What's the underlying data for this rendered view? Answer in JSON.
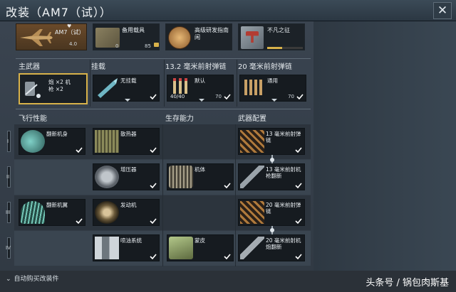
{
  "window": {
    "title": "改装（AM7（试））",
    "close_glyph": "✕"
  },
  "top_items": [
    {
      "name": "AM7（试）",
      "value": "4.0",
      "heart": "♥"
    },
    {
      "name": "备用载具",
      "left_count": "0",
      "right_count": "85"
    },
    {
      "name": "高级研发指南",
      "extra": "闲"
    },
    {
      "name": "不凡之征"
    }
  ],
  "columns": [
    {
      "label": "主武器"
    },
    {
      "label": "挂载"
    },
    {
      "label": "13.2 毫米前射弹链"
    },
    {
      "label": "20 毫米前射弹链"
    }
  ],
  "main_weapon": {
    "line1": "炮 ×2 机",
    "line2": "枪 ×2"
  },
  "pylon": {
    "name": "无挂载"
  },
  "belt_132": {
    "name": "默认",
    "count_left": "40/40",
    "count_right": "70"
  },
  "belt_20": {
    "name": "通用",
    "count_right": "70"
  },
  "sections": [
    {
      "label": "飞行性能"
    },
    {
      "label": "生存能力"
    },
    {
      "label": "武器配置"
    }
  ],
  "tiers": [
    "I",
    "II",
    "III",
    "IV"
  ],
  "slots": {
    "r1": [
      {
        "name": "翻新机身"
      },
      {
        "name": "散热器"
      },
      {
        "name": "13 毫米前射弹链"
      }
    ],
    "r2": [
      {
        "name": "增压器"
      },
      {
        "name": "机体"
      },
      {
        "name": "13 毫米前射机枪翻新"
      }
    ],
    "r3": [
      {
        "name": "翻新机翼"
      },
      {
        "name": "发动机"
      },
      {
        "name": "20 毫米前射弹链"
      }
    ],
    "r4": [
      {
        "name": "喷油系统"
      },
      {
        "name": "蒙皮"
      },
      {
        "name": "20 毫米前射机炮翻新"
      }
    ]
  },
  "footer": {
    "auto_buy": "自动购买改装件",
    "watermark": "头条号 / 锅包肉斯基"
  },
  "colors": {
    "accent_gold": "#d8b24a",
    "check_white": "#ffffff",
    "slot_bg": "#161b20"
  }
}
